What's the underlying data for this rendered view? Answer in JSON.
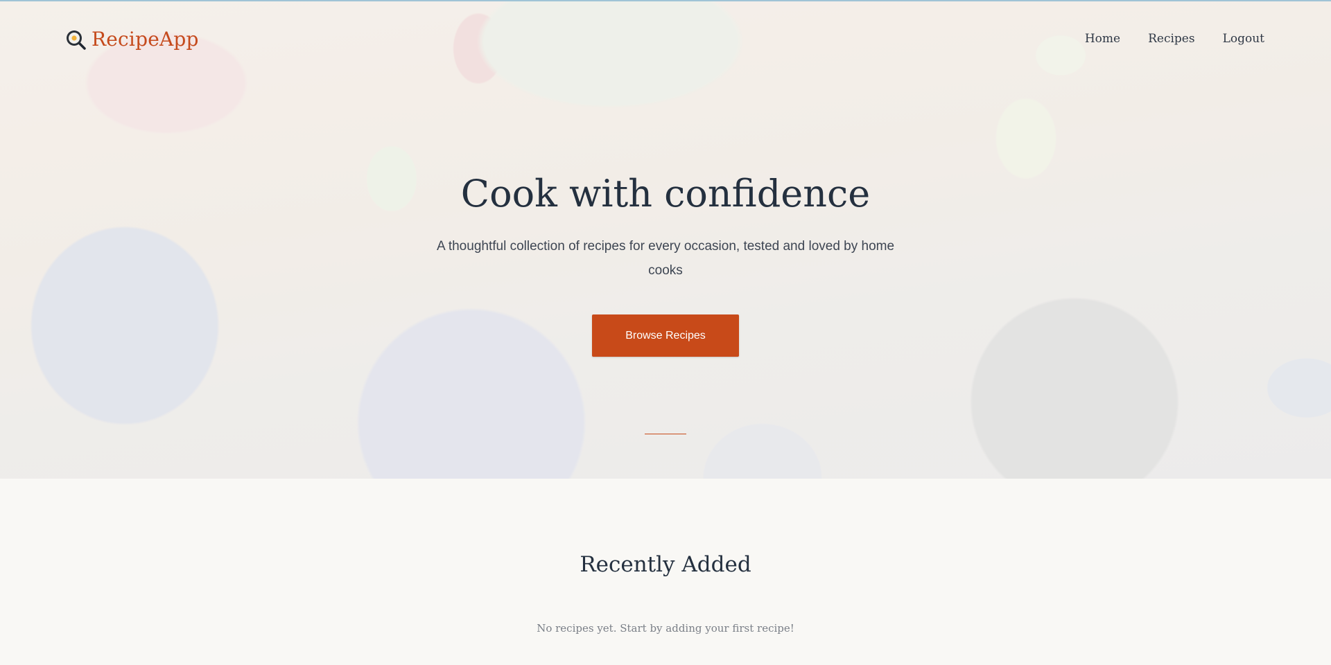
{
  "brand": {
    "name": "RecipeApp",
    "icon": "frying-pan-egg-icon",
    "color": "#c54a1c"
  },
  "nav": {
    "items": [
      {
        "label": "Home"
      },
      {
        "label": "Recipes"
      },
      {
        "label": "Logout"
      }
    ]
  },
  "hero": {
    "title": "Cook with confidence",
    "subtitle": "A thoughtful collection of recipes for every occasion, tested and loved by home cooks",
    "cta_label": "Browse Recipes",
    "accent": "#c84a19"
  },
  "recent": {
    "title": "Recently Added",
    "empty_message": "No recipes yet. Start by adding your first recipe!"
  }
}
